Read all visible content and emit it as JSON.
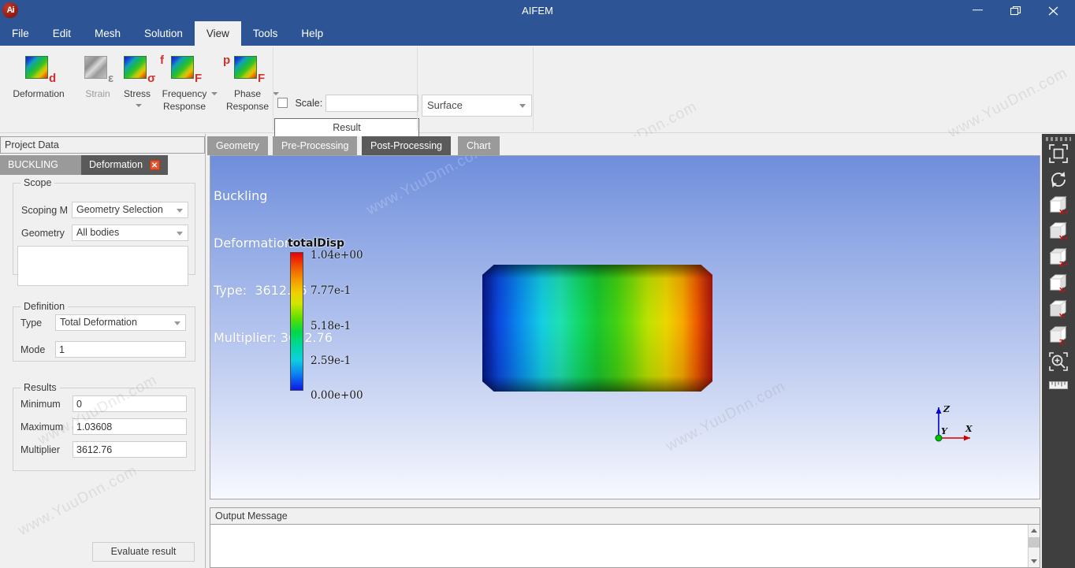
{
  "window": {
    "title": "AIFEM",
    "logo_text": "Ai",
    "minimize_label": "minimize",
    "maximize_label": "maximize",
    "close_label": "close"
  },
  "menu": {
    "items": [
      {
        "label": "File",
        "active": false
      },
      {
        "label": "Edit",
        "active": false
      },
      {
        "label": "Mesh",
        "active": false
      },
      {
        "label": "Solution",
        "active": false
      },
      {
        "label": "View",
        "active": true
      },
      {
        "label": "Tools",
        "active": false
      },
      {
        "label": "Help",
        "active": false
      }
    ]
  },
  "ribbon": {
    "items": [
      {
        "label": "Deformation",
        "glyph": "d",
        "glyph_pos": "br",
        "glyph_color": "red",
        "enabled": true,
        "dropdown": false
      },
      {
        "label": "Strain",
        "glyph": "ε",
        "glyph_pos": "br",
        "glyph_color": "grey",
        "enabled": false,
        "dropdown": false
      },
      {
        "label": "Stress",
        "glyph": "σ",
        "glyph_pos": "br",
        "glyph_color": "red",
        "enabled": true,
        "dropdown": true
      },
      {
        "label": "Frequency Response",
        "glyph": "F",
        "glyph_pos": "br",
        "glyph_color": "red",
        "enabled": true,
        "dropdown": true,
        "prefix": "f"
      },
      {
        "label": "Phase Response",
        "glyph": "F",
        "glyph_pos": "br",
        "glyph_color": "red",
        "enabled": true,
        "dropdown": true,
        "prefix": "p"
      }
    ],
    "scale_label": "Scale:",
    "scale_value": "",
    "scale_checked": false,
    "result_label": "Result",
    "surface_value": "Surface"
  },
  "left_panel": {
    "header": "Project Data",
    "tabs": [
      {
        "label": "BUCKLING",
        "active": false,
        "closable": false
      },
      {
        "label": "Deformation",
        "active": true,
        "closable": true,
        "close_glyph": "✕"
      }
    ],
    "scope": {
      "title": "Scope",
      "scoping_method_label": "Scoping M",
      "scoping_method_value": "Geometry Selection",
      "geometry_label": "Geometry",
      "geometry_value": "All bodies",
      "selection_list_value": ""
    },
    "definition": {
      "title": "Definition",
      "type_label": "Type",
      "type_value": "Total Deformation",
      "mode_label": "Mode",
      "mode_value": "1"
    },
    "results": {
      "title": "Results",
      "minimum_label": "Minimum",
      "minimum_value": "0",
      "maximum_label": "Maximum",
      "maximum_value": "1.03608",
      "multiplier_label": "Multiplier",
      "multiplier_value": "3612.76"
    },
    "evaluate_button": "Evaluate result"
  },
  "viewport": {
    "tabs": [
      {
        "label": "Geometry",
        "active": false
      },
      {
        "label": "Pre-Processing",
        "active": false
      },
      {
        "label": "Post-Processing",
        "active": true
      },
      {
        "label": "Chart",
        "active": false
      }
    ],
    "overlay_lines": [
      "Buckling",
      "Deformation",
      "Type:  3612.76",
      "Multiplier: 3612.76"
    ],
    "legend": {
      "title": "totalDisp",
      "ticks": [
        "1.04e+00",
        "7.77e-1",
        "5.18e-1",
        "2.59e-1",
        "0.00e+00"
      ]
    },
    "triad": {
      "x_label": "X",
      "y_label": "Y",
      "z_label": "Z",
      "x_color": "#d00000",
      "y_color": "#00a000",
      "z_color": "#0000d0"
    }
  },
  "right_toolbar": {
    "items": [
      {
        "name": "fit-view-icon",
        "label": "Fit View"
      },
      {
        "name": "rotate-icon",
        "label": "Rotate"
      },
      {
        "name": "view-xplus-icon",
        "label": "X+",
        "axis": "X+"
      },
      {
        "name": "view-yplus-icon",
        "label": "Y+",
        "axis": "Y+"
      },
      {
        "name": "view-zplus-icon",
        "label": "Z+",
        "axis": "Z+"
      },
      {
        "name": "view-xminus-icon",
        "label": "X-",
        "axis": "X-"
      },
      {
        "name": "view-yminus-icon",
        "label": "Y-",
        "axis": "Y-"
      },
      {
        "name": "view-zminus-icon",
        "label": "Z-",
        "axis": "Z-"
      },
      {
        "name": "zoom-box-icon",
        "label": "Zoom"
      },
      {
        "name": "measure-icon",
        "label": "Measure"
      }
    ]
  },
  "output": {
    "header": "Output Message",
    "text": ""
  },
  "watermarks": [
    "www.YuuDnn.com",
    "www.YuuDnn.com",
    "www.YuuDnn.com",
    "www.YuuDnn.com",
    "www.YuuDnn.com",
    "www.YuuDnn.com"
  ],
  "colors": {
    "titlebar": "#2d5596",
    "ribbon_bg": "#f0f0f0",
    "tab_active": "#5a5a5a",
    "tab_inactive": "#9a9a9a",
    "accent_red": "#d32f2f",
    "toolbar_dark": "#3f3f3f"
  }
}
